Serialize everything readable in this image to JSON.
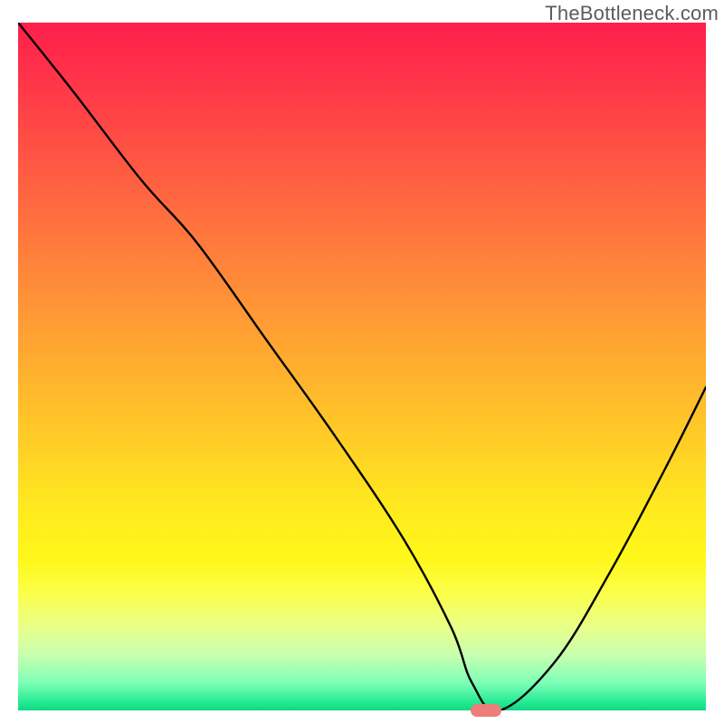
{
  "watermark": "TheBottleneck.com",
  "chart_data": {
    "type": "line",
    "title": "",
    "xlabel": "",
    "ylabel": "",
    "xlim": [
      0,
      100
    ],
    "ylim": [
      0,
      100
    ],
    "grid": false,
    "legend": false,
    "background_gradient": {
      "stops": [
        {
          "pos": 0,
          "color": "#ff1f4b"
        },
        {
          "pos": 18,
          "color": "#ff5044"
        },
        {
          "pos": 45,
          "color": "#ffa033"
        },
        {
          "pos": 70,
          "color": "#ffe81f"
        },
        {
          "pos": 88,
          "color": "#e7ff8a"
        },
        {
          "pos": 96,
          "color": "#7dffb7"
        },
        {
          "pos": 100,
          "color": "#14d583"
        }
      ]
    },
    "series": [
      {
        "name": "bottleneck-curve",
        "x": [
          0,
          8,
          18,
          26,
          36,
          46,
          56,
          63,
          66,
          70,
          78,
          86,
          94,
          100
        ],
        "values": [
          100,
          90,
          77,
          68,
          54,
          40,
          25,
          12,
          4,
          0,
          7,
          20,
          35,
          47
        ]
      }
    ],
    "marker": {
      "name": "optimal-point",
      "x": 68,
      "y": 0,
      "color": "#ec7d78"
    }
  }
}
